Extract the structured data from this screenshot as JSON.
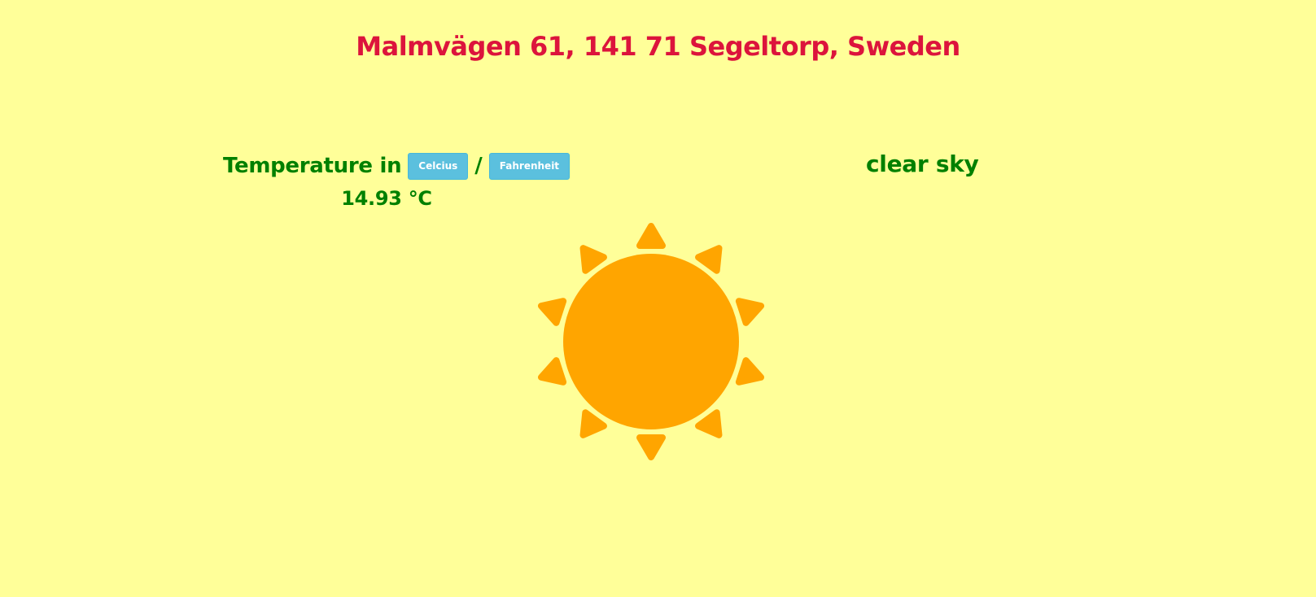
{
  "location": {
    "address": "Malmvägen 61, 141 71 Segeltorp, Sweden"
  },
  "temperature": {
    "label": "Temperature in",
    "celsius_button": "Celcius",
    "separator": "/",
    "fahrenheit_button": "Fahrenheit",
    "value": "14.93 °C"
  },
  "weather": {
    "description": "clear sky",
    "icon": "sun-icon"
  },
  "colors": {
    "background": "#ffff99",
    "address": "#dc143c",
    "text": "#008000",
    "button": "#5bc0de",
    "sun": "#ffa500"
  }
}
